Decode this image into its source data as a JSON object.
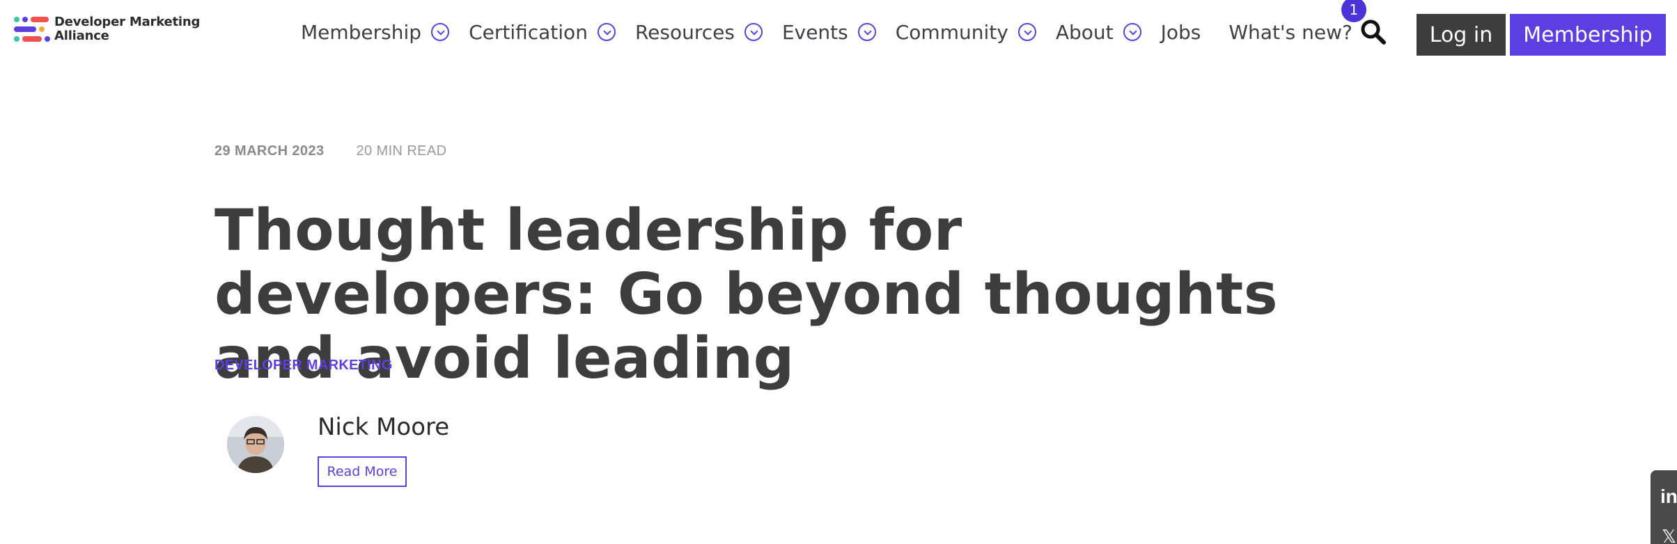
{
  "brand": {
    "name_line1": "Developer Marketing",
    "name_line2": "Alliance",
    "logo_colors": [
      "#3cc4a4",
      "#f0534f",
      "#5b3fe0",
      "#f2a93b"
    ]
  },
  "nav": {
    "items": [
      {
        "label": "Membership",
        "has_dropdown": true
      },
      {
        "label": "Certification",
        "has_dropdown": true
      },
      {
        "label": "Resources",
        "has_dropdown": true
      },
      {
        "label": "Events",
        "has_dropdown": true
      },
      {
        "label": "Community",
        "has_dropdown": true
      },
      {
        "label": "About",
        "has_dropdown": true
      },
      {
        "label": "Jobs",
        "has_dropdown": false
      },
      {
        "label": "What's new?",
        "has_dropdown": false
      }
    ],
    "whats_new_badge": "1",
    "search_icon": "search-icon",
    "login_label": "Log in",
    "membership_label": "Membership"
  },
  "article": {
    "date": "29 MARCH 2023",
    "read_time": "20 MIN READ",
    "title": "Thought leadership for developers: Go beyond thoughts and avoid leading",
    "category": "DEVELOPER MARKETING",
    "author": {
      "name": "Nick Moore",
      "read_more_label": "Read More"
    }
  },
  "share": {
    "icons": [
      "linkedin-icon",
      "x-icon"
    ],
    "linkedin_glyph": "in",
    "x_glyph": "𝕏"
  },
  "colors": {
    "accent": "#5b3fe0",
    "dark_button": "#3d3d3d",
    "text": "#3d3d3d"
  }
}
